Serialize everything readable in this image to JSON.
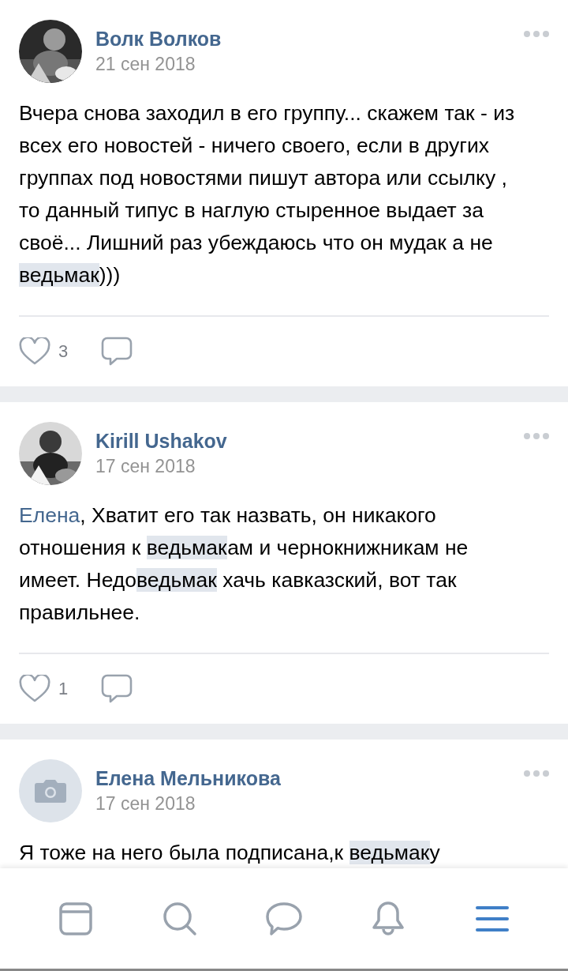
{
  "posts": [
    {
      "author": "Волк Волков",
      "date": "21 сен 2018",
      "body": [
        {
          "kind": "plain",
          "text": "Вчера снова заходил в его группу... скажем так - из всех его новостей - ничего своего, если в других группах под новостями пишут автора или ссылку , то данный типус в наглую стыренное выдает за своё... Лишний раз убеждаюсь что он мудак а не "
        },
        {
          "kind": "highlight",
          "text": "ведьмак"
        },
        {
          "kind": "plain",
          "text": ")))"
        }
      ],
      "likes": "3"
    },
    {
      "author": "Kirill Ushakov",
      "date": "17 сен 2018",
      "body": [
        {
          "kind": "mention",
          "text": "Елена"
        },
        {
          "kind": "plain",
          "text": ", Хватит его так назвать, он никакого отношения к "
        },
        {
          "kind": "highlight",
          "text": "ведьмак"
        },
        {
          "kind": "plain",
          "text": "ам и чернокнижникам не имеет. Недо"
        },
        {
          "kind": "highlight",
          "text": "ведьмак"
        },
        {
          "kind": "plain",
          "text": " хачь кавказский, вот так правильнее."
        }
      ],
      "likes": "1"
    },
    {
      "author": "Елена Мельникова",
      "date": "17 сен 2018",
      "avatar": {
        "kind": "placeholder"
      },
      "body": [
        {
          "kind": "plain",
          "text": "Я тоже на него была подписана,к "
        },
        {
          "kind": "highlight",
          "text": "ведьмак"
        },
        {
          "kind": "plain",
          "text": "у"
        }
      ]
    }
  ],
  "nav": [
    {
      "kind": "news",
      "selected": false
    },
    {
      "kind": "search",
      "selected": false
    },
    {
      "kind": "messages",
      "selected": false
    },
    {
      "kind": "notifications",
      "selected": false
    },
    {
      "kind": "menu",
      "selected": true
    }
  ]
}
